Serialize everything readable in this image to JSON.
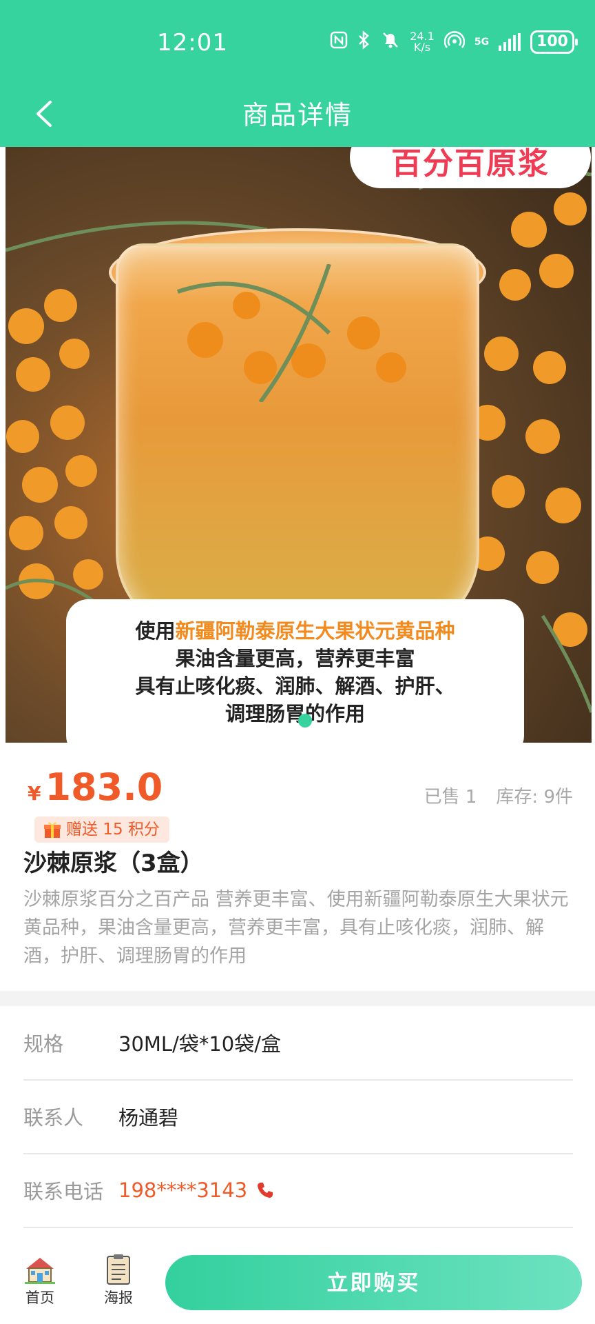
{
  "status_bar": {
    "time": "12:01",
    "net_speed_value": "24.1",
    "net_speed_unit": "K/s",
    "network": "5G",
    "battery": "100"
  },
  "nav": {
    "title": "商品详情"
  },
  "product_image": {
    "banner_tag": "百分百原浆",
    "caption": {
      "line1_prefix": "使用",
      "line1_highlight": "新疆阿勒泰原生大果状元黄品种",
      "line2": "果油含量更高，营养更丰富",
      "line3": "具有止咳化痰、润肺、解酒、护肝、",
      "line4": "调理肠胃的作用"
    }
  },
  "product": {
    "currency": "¥",
    "price": "183.0",
    "sold": "已售 1",
    "stock": "库存: 9件",
    "points": "赠送 15 积分",
    "name": "沙棘原浆（3盒）",
    "description": "沙棘原浆百分之百产品 营养更丰富、使用新疆阿勒泰原生大果状元黄品种，果油含量更高，营养更丰富，具有止咳化痰，润肺、解酒，护肝、调理肠胃的作用"
  },
  "details": {
    "spec_label": "规格",
    "spec_value": "30ML/袋*10袋/盒",
    "contact_label": "联系人",
    "contact_value": "杨通碧",
    "phone_label": "联系电话",
    "phone_value": "198****3143"
  },
  "bottom_bar": {
    "home_label": "首页",
    "poster_label": "海报",
    "buy_label": "立即购买"
  },
  "colors": {
    "primary": "#36d39f",
    "price": "#f05a28",
    "highlight": "#f28a1e",
    "banner_text": "#ef3b54"
  }
}
